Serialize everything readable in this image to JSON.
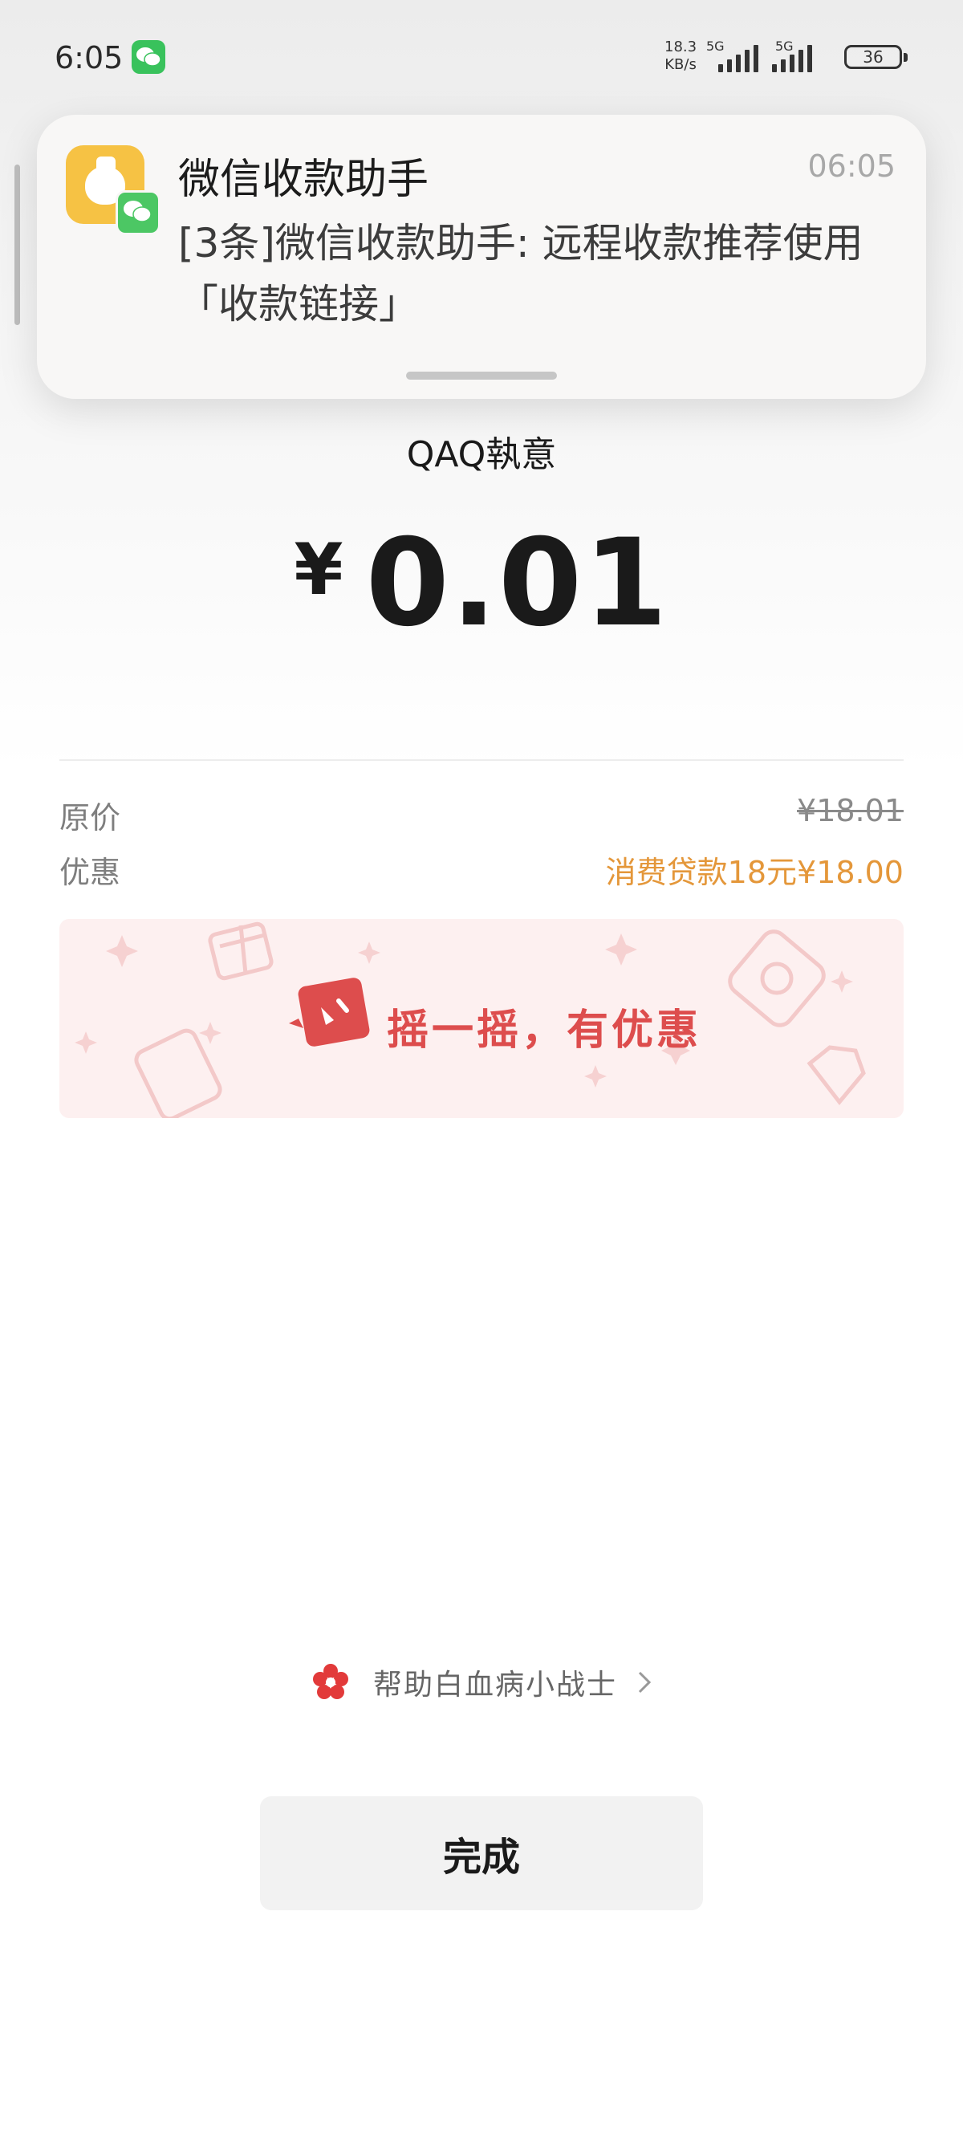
{
  "status_bar": {
    "time": "6:05",
    "speed_value": "18.3",
    "speed_unit": "KB/s",
    "network1": "5G",
    "network2": "5G",
    "battery": "36"
  },
  "notification": {
    "app_name": "微信收款助手",
    "time": "06:05",
    "message": "[3条]微信收款助手: 远程收款推荐使用「收款链接」"
  },
  "payment": {
    "payee": "QAQ執意",
    "currency": "¥",
    "amount": "0.01",
    "original_price_label": "原价",
    "original_price": "¥18.01",
    "discount_label": "优惠",
    "discount_value": "消费贷款18元¥18.00"
  },
  "banner": {
    "text": "摇一摇，有优惠"
  },
  "footer": {
    "charity_label": "帮助白血病小战士",
    "done_label": "完成"
  },
  "colors": {
    "discount": "#e4973a",
    "banner_text": "#dd4d4d",
    "wechat_green": "#39c25c"
  }
}
